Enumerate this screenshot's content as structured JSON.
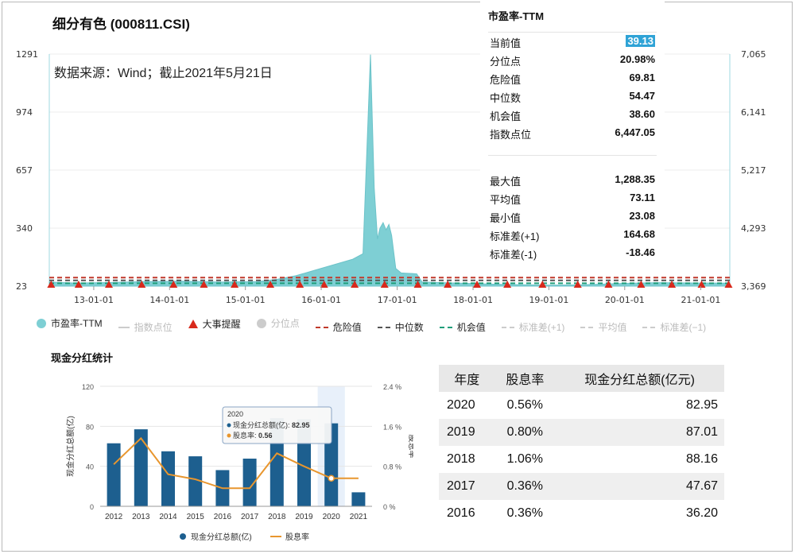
{
  "title": "细分有色 (000811.CSI)",
  "source_note": "数据来源：Wind；截止2021年5月21日",
  "chart_data": [
    {
      "type": "area",
      "title": "细分有色 (000811.CSI)",
      "x_ticks": [
        "13-01-01",
        "14-01-01",
        "15-01-01",
        "16-01-01",
        "17-01-01",
        "18-01-01",
        "19-01-01",
        "20-01-01",
        "21-01-01"
      ],
      "y_left_ticks": [
        "1291",
        "974",
        "657",
        "340",
        "23"
      ],
      "y_left_range": [
        23,
        1291
      ],
      "y_right_ticks": [
        "7,065",
        "6,141",
        "5,217",
        "4,293",
        "3,369"
      ],
      "y_right_range": [
        3369,
        7065
      ],
      "x_range": [
        "2012-06-01",
        "2021-05-21"
      ],
      "series": [
        {
          "name": "市盈率-TTM",
          "color": "#7ecfd4",
          "points": [
            [
              "2012-06-01",
              45
            ],
            [
              "2012-10-01",
              40
            ],
            [
              "2013-03-01",
              42
            ],
            [
              "2013-09-01",
              48
            ],
            [
              "2014-03-01",
              50
            ],
            [
              "2014-09-01",
              45
            ],
            [
              "2015-03-01",
              48
            ],
            [
              "2015-06-01",
              60
            ],
            [
              "2015-09-01",
              80
            ],
            [
              "2015-12-01",
              110
            ],
            [
              "2016-03-01",
              140
            ],
            [
              "2016-06-01",
              170
            ],
            [
              "2016-07-20",
              200
            ],
            [
              "2016-08-25",
              1288
            ],
            [
              "2016-09-12",
              560
            ],
            [
              "2016-09-28",
              280
            ],
            [
              "2016-10-10",
              340
            ],
            [
              "2016-10-25",
              370
            ],
            [
              "2016-11-08",
              330
            ],
            [
              "2016-11-22",
              360
            ],
            [
              "2016-12-05",
              300
            ],
            [
              "2016-12-25",
              120
            ],
            [
              "2017-01-20",
              95
            ],
            [
              "2017-03-15",
              92
            ],
            [
              "2017-04-05",
              90
            ],
            [
              "2017-05-01",
              45
            ],
            [
              "2017-12-01",
              38
            ],
            [
              "2018-06-01",
              32
            ],
            [
              "2019-01-01",
              28
            ],
            [
              "2019-06-01",
              30
            ],
            [
              "2020-01-01",
              38
            ],
            [
              "2020-06-01",
              42
            ],
            [
              "2021-01-01",
              40
            ],
            [
              "2021-05-21",
              39
            ]
          ]
        }
      ],
      "reference_lines": [
        {
          "name": "危险值",
          "value": 69.81,
          "color": "#c0392b"
        },
        {
          "name": "中位数",
          "value": 54.47,
          "color": "#555555"
        },
        {
          "name": "机会值",
          "value": 38.6,
          "color": "#1f9e7a"
        }
      ],
      "event_markers_dates": [
        "2012-06-10",
        "2012-10-20",
        "2013-03-15",
        "2013-08-20",
        "2014-01-20",
        "2014-06-15",
        "2014-11-10",
        "2015-05-01",
        "2015-09-20",
        "2016-01-15",
        "2016-06-10",
        "2016-11-01",
        "2017-04-10",
        "2017-09-01",
        "2018-01-20",
        "2018-06-15",
        "2018-12-01",
        "2019-05-20",
        "2019-10-15",
        "2020-03-20",
        "2020-08-15",
        "2021-01-05",
        "2021-05-15"
      ],
      "stats": {
        "title": "市盈率-TTM",
        "rows_a": [
          {
            "label": "当前值",
            "value": "39.13",
            "highlight": true
          },
          {
            "label": "分位点",
            "value": "20.98%"
          },
          {
            "label": "危险值",
            "value": "69.81"
          },
          {
            "label": "中位数",
            "value": "54.47"
          },
          {
            "label": "机会值",
            "value": "38.60"
          },
          {
            "label": "指数点位",
            "value": "6,447.05"
          }
        ],
        "rows_b": [
          {
            "label": "最大值",
            "value": "1,288.35"
          },
          {
            "label": "平均值",
            "value": "73.11"
          },
          {
            "label": "最小值",
            "value": "23.08"
          },
          {
            "label": "标准差(+1)",
            "value": "164.68"
          },
          {
            "label": "标准差(-1)",
            "value": "-18.46"
          }
        ]
      },
      "legend": [
        {
          "label": "市盈率-TTM",
          "marker": "dot",
          "color": "#7ecfd4",
          "active": true
        },
        {
          "label": "指数点位",
          "marker": "line",
          "color": "#cccccc",
          "active": false
        },
        {
          "label": "大事提醒",
          "marker": "triangle",
          "color": "#d8291c",
          "active": true
        },
        {
          "label": "分位点",
          "marker": "dot",
          "color": "#cccccc",
          "active": false
        },
        {
          "label": "危险值",
          "marker": "dash",
          "color": "#c0392b",
          "active": true
        },
        {
          "label": "中位数",
          "marker": "dash",
          "color": "#555555",
          "active": true
        },
        {
          "label": "机会值",
          "marker": "dash",
          "color": "#1f9e7a",
          "active": true
        },
        {
          "label": "标准差(+1)",
          "marker": "dash",
          "color": "#cccccc",
          "active": false
        },
        {
          "label": "平均值",
          "marker": "dash",
          "color": "#cccccc",
          "active": false
        },
        {
          "label": "标准差(−1)",
          "marker": "dash",
          "color": "#cccccc",
          "active": false
        }
      ]
    },
    {
      "type": "bar",
      "title": "现金分红统计",
      "categories": [
        "2012",
        "2013",
        "2014",
        "2015",
        "2016",
        "2017",
        "2018",
        "2019",
        "2020",
        "2021"
      ],
      "y_left_label": "现金分红总额(亿)",
      "y_left_ticks": [
        "120",
        "80",
        "40",
        "0"
      ],
      "y_left_range": [
        0,
        120
      ],
      "y_right_label": "股息率",
      "y_right_ticks": [
        "2.4 %",
        "1.6 %",
        "0.8 %",
        "0 %"
      ],
      "y_right_range": [
        0,
        2.4
      ],
      "series": [
        {
          "name": "现金分红总额(亿)",
          "type": "bar",
          "color": "#1d5f8f",
          "values": [
            63,
            77,
            55,
            50,
            36.2,
            47.67,
            88.16,
            87.01,
            82.95,
            14
          ]
        },
        {
          "name": "股息率",
          "type": "line",
          "color": "#e8962e",
          "values": [
            0.84,
            1.36,
            0.64,
            0.54,
            0.36,
            0.36,
            1.06,
            0.8,
            0.56,
            0.56
          ]
        }
      ],
      "highlight_category": "2020",
      "tooltip": {
        "title": "2020",
        "bar_label": "现金分红总额(亿): ",
        "bar_value": "82.95",
        "line_label": "股息率: ",
        "line_value": "0.56"
      }
    }
  ],
  "table": {
    "headers": [
      "年度",
      "股息率",
      "现金分红总额(亿元)"
    ],
    "rows": [
      [
        "2020",
        "0.56%",
        "82.95"
      ],
      [
        "2019",
        "0.80%",
        "87.01"
      ],
      [
        "2018",
        "1.06%",
        "88.16"
      ],
      [
        "2017",
        "0.36%",
        "47.67"
      ],
      [
        "2016",
        "0.36%",
        "36.20"
      ]
    ]
  }
}
